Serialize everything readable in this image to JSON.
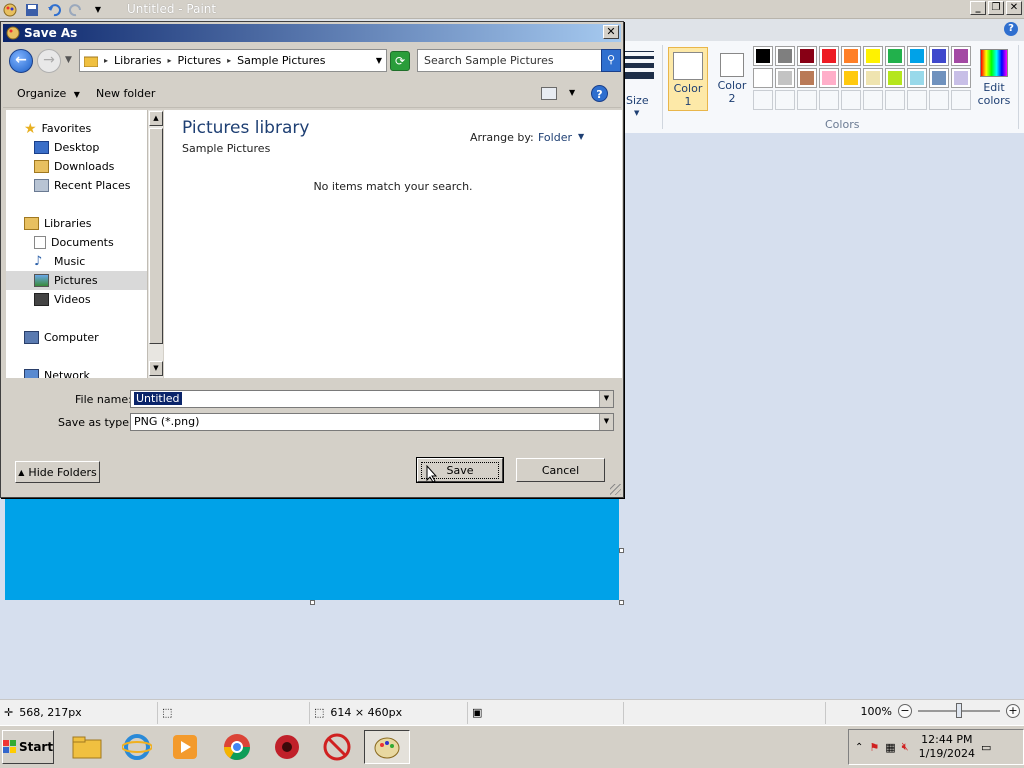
{
  "paint": {
    "title": "Untitled - Paint",
    "ribbon": {
      "size_label": "Size",
      "color1_label": "Color",
      "color1_num": "1",
      "color2_label": "Color",
      "color2_num": "2",
      "edit_colors_line1": "Edit",
      "edit_colors_line2": "colors",
      "colors_group_label": "Colors",
      "palette_row1": [
        "#000000",
        "#7f7f7f",
        "#880015",
        "#ed1c24",
        "#ff7f27",
        "#fff200",
        "#22b14c",
        "#00a2e8",
        "#3f48cc",
        "#a349a4"
      ],
      "palette_row2": [
        "#ffffff",
        "#c3c3c3",
        "#b97a57",
        "#ffaec9",
        "#ffc90e",
        "#efe4b0",
        "#b5e61d",
        "#99d9ea",
        "#7092be",
        "#c8bfe7"
      ],
      "canvas_color": "#00a2e8"
    },
    "status": {
      "cursor_pos": "568, 217px",
      "image_size": "614 × 460px",
      "zoom": "100%"
    }
  },
  "dialog": {
    "title": "Save As",
    "breadcrumb": [
      "Libraries",
      "Pictures",
      "Sample Pictures"
    ],
    "search_placeholder": "Search Sample Pictures",
    "organize": "Organize",
    "new_folder": "New folder",
    "nav": {
      "favorites": "Favorites",
      "desktop": "Desktop",
      "downloads": "Downloads",
      "recent_places": "Recent Places",
      "libraries": "Libraries",
      "documents": "Documents",
      "music": "Music",
      "pictures": "Pictures",
      "videos": "Videos",
      "computer": "Computer",
      "network": "Network"
    },
    "content": {
      "title": "Pictures library",
      "subtitle": "Sample Pictures",
      "arrange_label": "Arrange by:",
      "arrange_value": "Folder",
      "empty_message": "No items match your search."
    },
    "file_name_label": "File name:",
    "file_name_value": "Untitled",
    "save_type_label": "Save as type:",
    "save_type_value": "PNG (*.png)",
    "hide_folders": "Hide Folders",
    "save": "Save",
    "cancel": "Cancel"
  },
  "taskbar": {
    "start": "Start",
    "time": "12:44 PM",
    "date": "1/19/2024"
  }
}
